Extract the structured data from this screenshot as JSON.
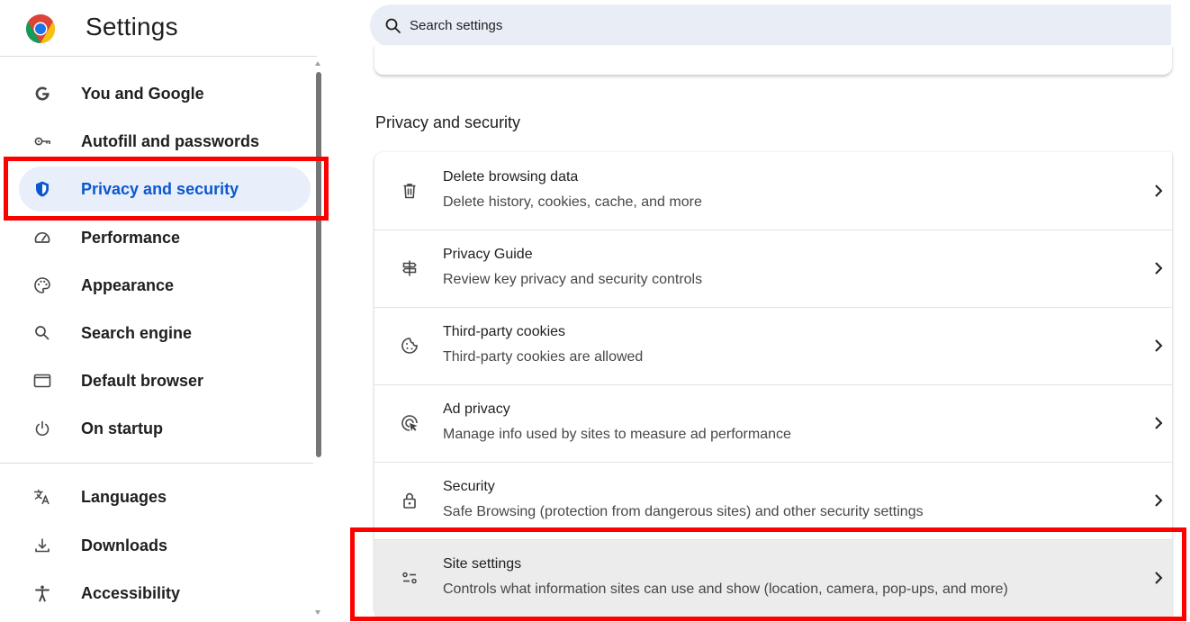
{
  "header": {
    "title": "Settings",
    "search_placeholder": "Search settings"
  },
  "sidebar": {
    "items": [
      {
        "label": "You and Google",
        "icon": "google-g-icon"
      },
      {
        "label": "Autofill and passwords",
        "icon": "key-icon"
      },
      {
        "label": "Privacy and security",
        "icon": "shield-icon",
        "active": true
      },
      {
        "label": "Performance",
        "icon": "speedometer-icon"
      },
      {
        "label": "Appearance",
        "icon": "palette-icon"
      },
      {
        "label": "Search engine",
        "icon": "search-icon"
      },
      {
        "label": "Default browser",
        "icon": "browser-window-icon"
      },
      {
        "label": "On startup",
        "icon": "power-icon"
      },
      {
        "label": "Languages",
        "icon": "translate-icon"
      },
      {
        "label": "Downloads",
        "icon": "download-icon"
      },
      {
        "label": "Accessibility",
        "icon": "accessibility-icon"
      }
    ]
  },
  "main": {
    "section_title": "Privacy and security",
    "rows": [
      {
        "title": "Delete browsing data",
        "subtitle": "Delete history, cookies, cache, and more",
        "icon": "trash-icon"
      },
      {
        "title": "Privacy Guide",
        "subtitle": "Review key privacy and security controls",
        "icon": "signpost-icon"
      },
      {
        "title": "Third-party cookies",
        "subtitle": "Third-party cookies are allowed",
        "icon": "cookie-icon"
      },
      {
        "title": "Ad privacy",
        "subtitle": "Manage info used by sites to measure ad performance",
        "icon": "ad-target-icon"
      },
      {
        "title": "Security",
        "subtitle": "Safe Browsing (protection from dangerous sites) and other security settings",
        "icon": "lock-icon"
      },
      {
        "title": "Site settings",
        "subtitle": "Controls what information sites can use and show (location, camera, pop-ups, and more)",
        "icon": "tune-sliders-icon",
        "hovered": true
      }
    ]
  },
  "colors": {
    "accent": "#0b57d0",
    "active_nav_bg": "#e8effa",
    "search_bg": "#e9eef6",
    "highlight": "#ff0000",
    "hover_row_bg": "#ececec"
  }
}
